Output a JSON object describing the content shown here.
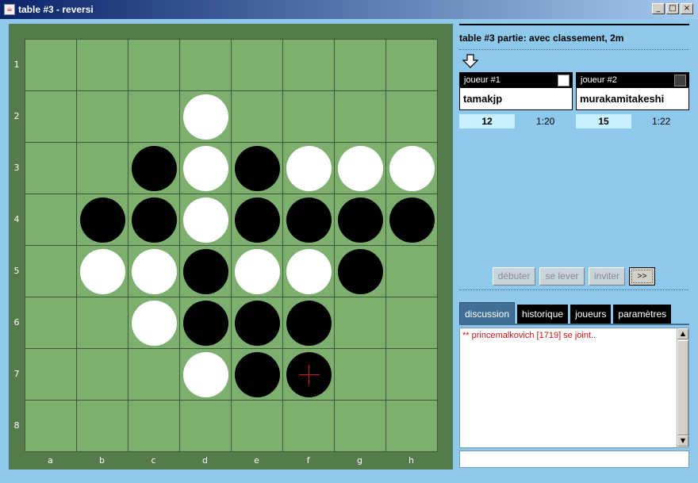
{
  "window": {
    "title": "table #3 - reversi",
    "minimize_glyph": "_",
    "maximize_glyph": "□",
    "close_glyph": "×"
  },
  "board": {
    "columns": [
      "a",
      "b",
      "c",
      "d",
      "e",
      "f",
      "g",
      "h"
    ],
    "rows": [
      "1",
      "2",
      "3",
      "4",
      "5",
      "6",
      "7",
      "8"
    ],
    "cells": [
      "........",
      "...W....",
      "..BWBWWW",
      ".BBWBBBB",
      ".WWBWWB.",
      "..WBBB..",
      "...WBB..",
      "........"
    ],
    "last_move": "f7",
    "marker_color": "#d81818"
  },
  "info": {
    "table_line": "table #3  partie: avec classement, 2m"
  },
  "players": [
    {
      "header": "joueur #1",
      "name": "tamakjp",
      "color_square": "#ffffff",
      "score": "12",
      "time": "1:20",
      "to_move": true
    },
    {
      "header": "joueur #2",
      "name": "murakamitakeshi",
      "color_square": "#404040",
      "score": "15",
      "time": "1:22",
      "to_move": false
    }
  ],
  "buttons": {
    "start": "débuter",
    "stand_up": "se lever",
    "invite": "inviter",
    "more": ">>"
  },
  "tabs": [
    {
      "label": "discussion",
      "selected": true
    },
    {
      "label": "historique",
      "selected": false
    },
    {
      "label": "joueurs",
      "selected": false
    },
    {
      "label": "paramètres",
      "selected": false
    }
  ],
  "chat": {
    "messages": [
      "** princemalkovich [1719] se joint.."
    ],
    "input_value": ""
  },
  "scroll": {
    "up_glyph": "▲",
    "down_glyph": "▼"
  }
}
